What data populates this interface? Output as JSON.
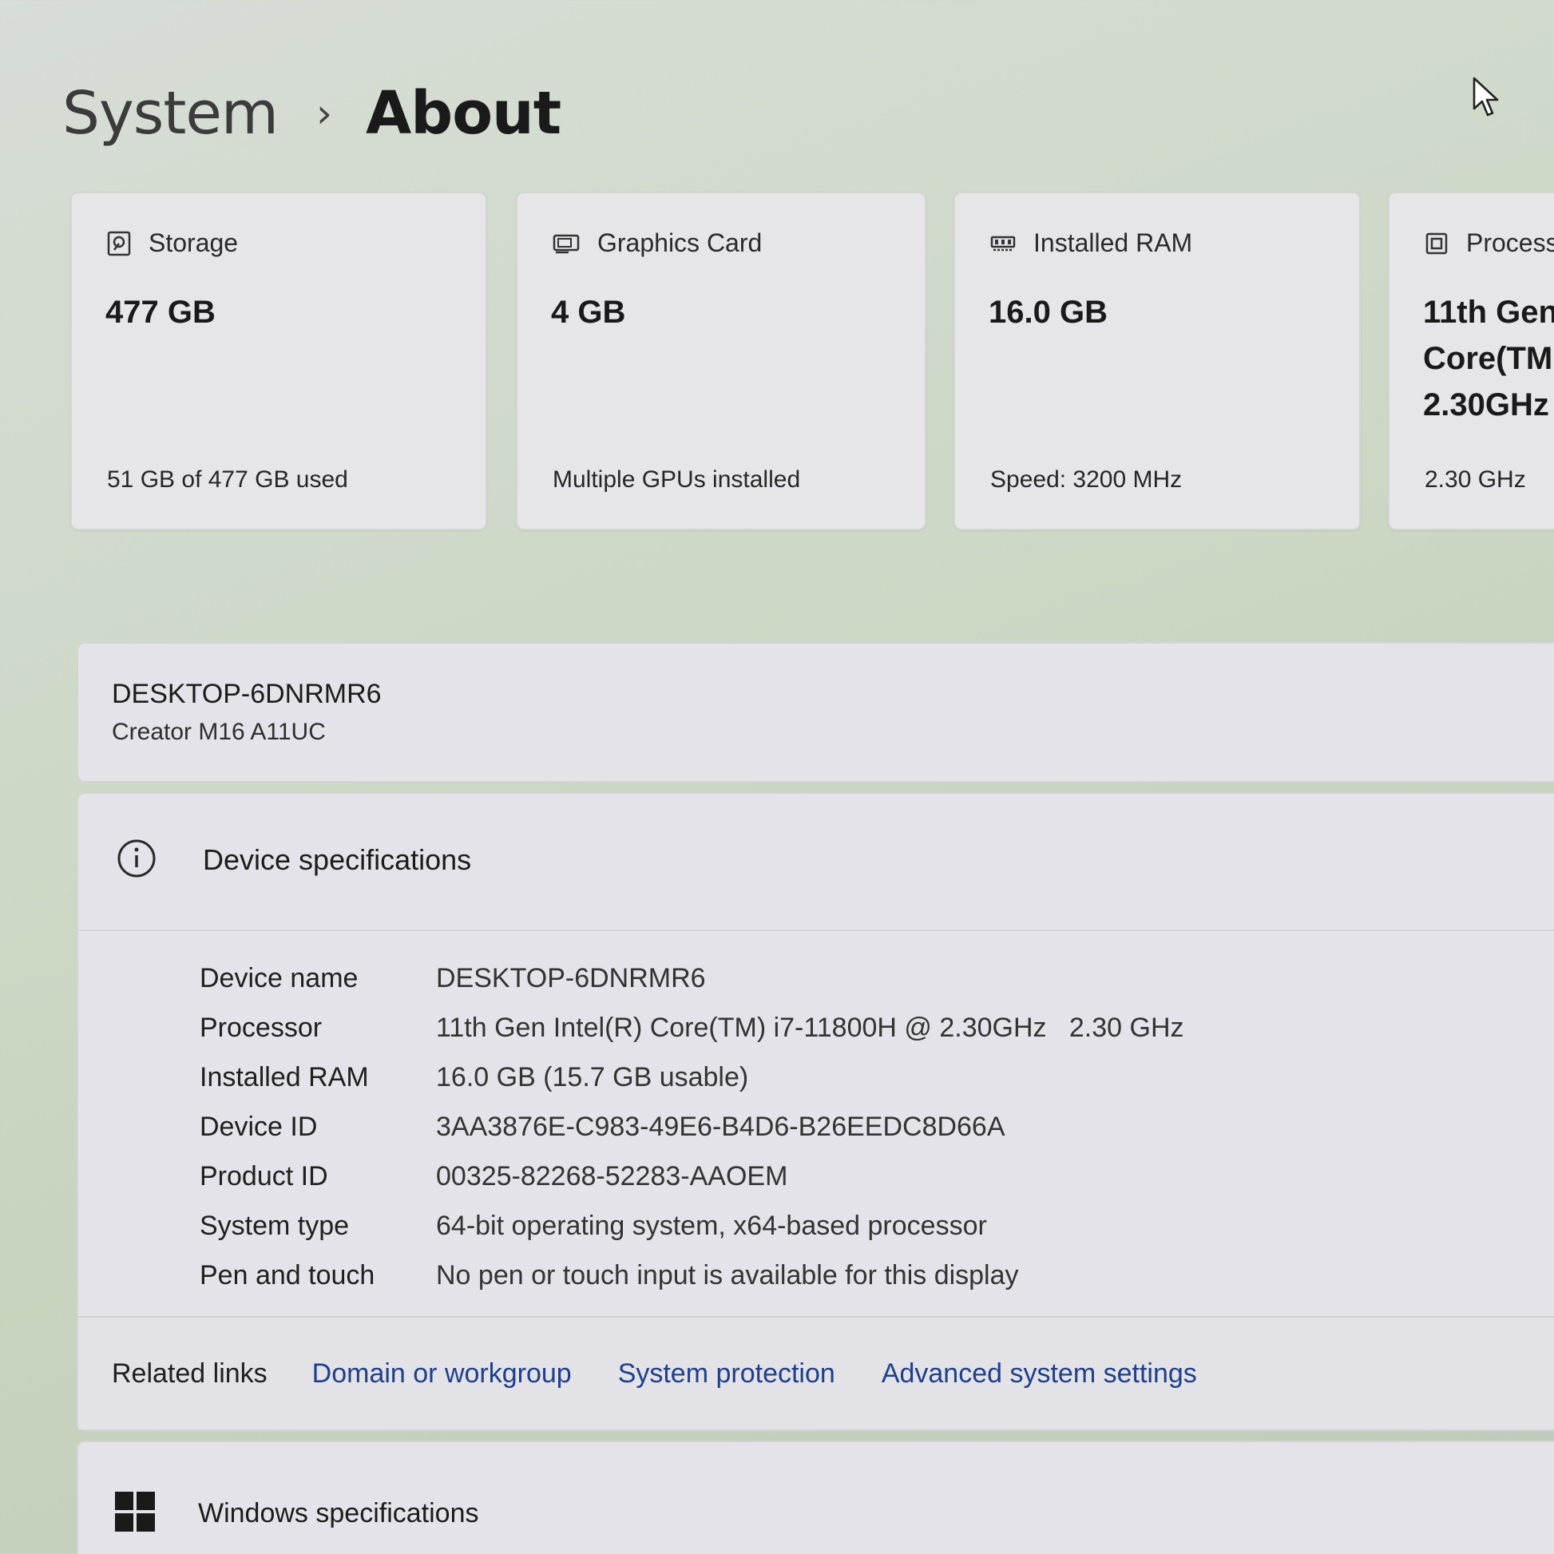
{
  "breadcrumb": {
    "parent": "System",
    "separator": "›",
    "current": "About"
  },
  "cards": [
    {
      "icon": "storage-icon",
      "label": "Storage",
      "value": "477 GB",
      "sub": "51 GB of 477 GB used"
    },
    {
      "icon": "graphics-card-icon",
      "label": "Graphics Card",
      "value": "4 GB",
      "sub": "Multiple GPUs installed"
    },
    {
      "icon": "ram-icon",
      "label": "Installed RAM",
      "value": "16.0 GB",
      "sub": "Speed: 3200 MHz"
    },
    {
      "icon": "processor-icon",
      "label": "Process",
      "value_lines": [
        "11th Gen",
        "Core(TM",
        "2.30GHz"
      ],
      "sub": "2.30 GHz"
    }
  ],
  "device": {
    "name": "DESKTOP-6DNRMR6",
    "model": "Creator M16 A11UC"
  },
  "device_specs": {
    "title": "Device specifications",
    "rows": [
      {
        "label": "Device name",
        "value": "DESKTOP-6DNRMR6"
      },
      {
        "label": "Processor",
        "value": "11th Gen Intel(R) Core(TM) i7-11800H @ 2.30GHz   2.30 GHz"
      },
      {
        "label": "Installed RAM",
        "value": "16.0 GB (15.7 GB usable)"
      },
      {
        "label": "Device ID",
        "value": "3AA3876E-C983-49E6-B4D6-B26EEDC8D66A"
      },
      {
        "label": "Product ID",
        "value": "00325-82268-52283-AAOEM"
      },
      {
        "label": "System type",
        "value": "64-bit operating system, x64-based processor"
      },
      {
        "label": "Pen and touch",
        "value": "No pen or touch input is available for this display"
      }
    ]
  },
  "related_links": {
    "label": "Related links",
    "links": [
      "Domain or workgroup",
      "System protection",
      "Advanced system settings"
    ]
  },
  "windows_specs": {
    "title": "Windows specifications"
  },
  "colors": {
    "link": "#1f3f8a",
    "card_bg": "#e6e6e9",
    "page_bg": "#cfd9c8"
  }
}
